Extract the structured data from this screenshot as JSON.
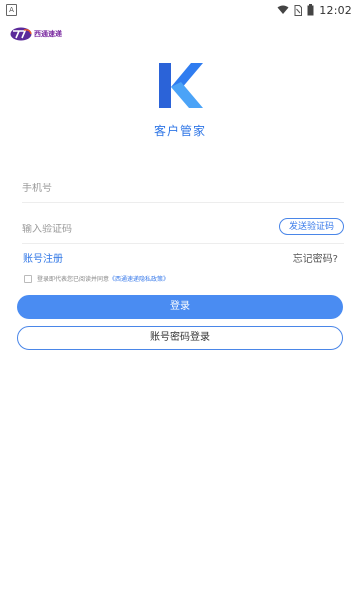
{
  "status_bar": {
    "left_icon": "A",
    "time": "12:02",
    "icons": [
      "wifi-icon",
      "sim-icon",
      "battery-icon"
    ]
  },
  "brand": {
    "logo_text": "西通速递"
  },
  "app": {
    "title": "客户管家"
  },
  "form": {
    "phone_placeholder": "手机号",
    "code_placeholder": "输入验证码",
    "send_code_label": "发送验证码",
    "register_label": "账号注册",
    "forgot_label": "忘记密码?",
    "agreement_text": "登录即代表您已阅读并同意",
    "agreement_link": "《西通速递隐私政策》",
    "login_label": "登录",
    "password_login_label": "账号密码登录"
  },
  "colors": {
    "accent": "#2f76e6",
    "button_fill": "#4a8cf2",
    "brand_purple": "#7a2aa0"
  }
}
